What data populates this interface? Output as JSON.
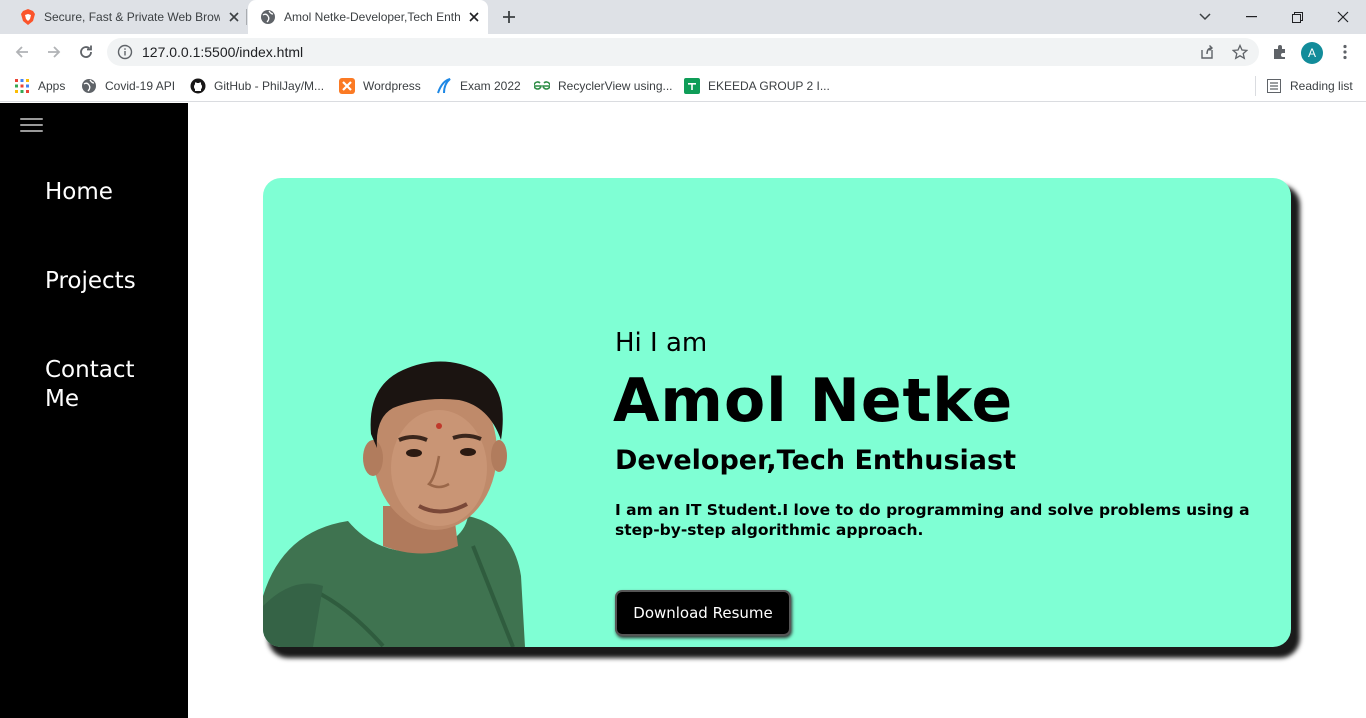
{
  "browser": {
    "tabs": [
      {
        "title": "Secure, Fast & Private Web Browser",
        "icon": "brave-lion-icon",
        "active": false
      },
      {
        "title": "Amol Netke-Developer,Tech Enthusiast",
        "icon": "globe-icon",
        "active": true
      }
    ],
    "url": "127.0.0.1:5500/index.html",
    "profile_initial": "A",
    "bookmarks": [
      {
        "label": "Apps",
        "icon": "apps-grid-icon"
      },
      {
        "label": "Covid-19 API",
        "icon": "globe-icon"
      },
      {
        "label": "GitHub - PhilJay/M...",
        "icon": "github-icon"
      },
      {
        "label": "Wordpress",
        "icon": "xampp-icon"
      },
      {
        "label": "Exam 2022",
        "icon": "a-logo-icon"
      },
      {
        "label": "RecyclerView using...",
        "icon": "gfg-icon"
      },
      {
        "label": "EKEEDA GROUP 2 I...",
        "icon": "sheets-icon"
      }
    ],
    "reading_list": "Reading list"
  },
  "sidebar": {
    "items": [
      {
        "label": "Home"
      },
      {
        "label": "Projects"
      },
      {
        "label": "Contact Me"
      }
    ]
  },
  "hero": {
    "greeting": "Hi I am",
    "name": "Amol Netke",
    "role": "Developer,Tech Enthusiast",
    "description": "I am an IT Student.I love to do programming and solve problems using a step-by-step algorithmic approach.",
    "button": "Download Resume"
  },
  "colors": {
    "card_bg": "#7fffd4",
    "sidebar_bg": "#000000",
    "avatar_bg": "#128c9a"
  }
}
